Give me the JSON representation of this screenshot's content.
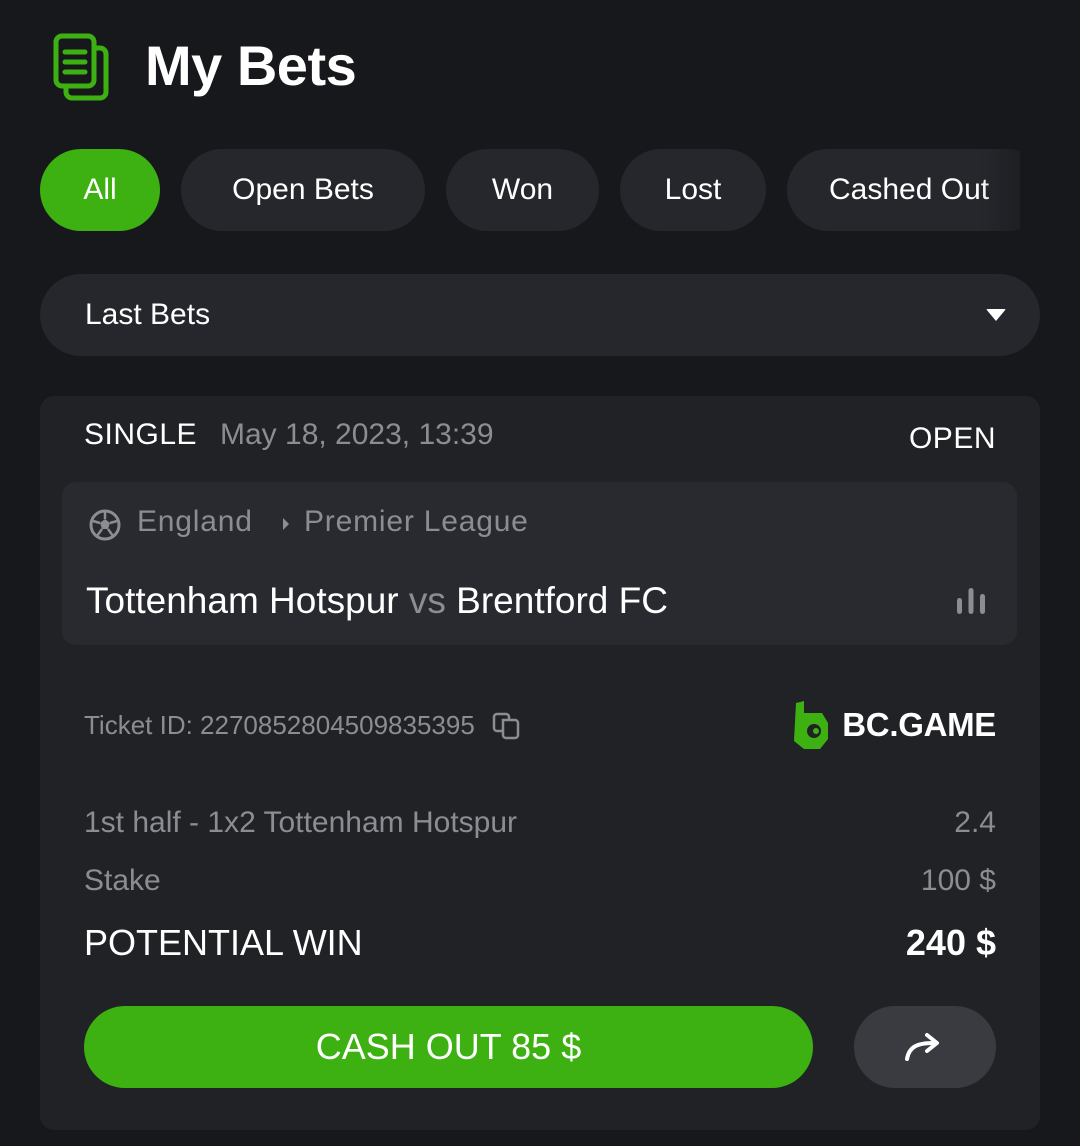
{
  "header": {
    "title": "My Bets",
    "icon": "bets-document-icon",
    "accent_color": "#3db112"
  },
  "filters": {
    "tabs": [
      {
        "label": "All",
        "active": true
      },
      {
        "label": "Open Bets",
        "active": false
      },
      {
        "label": "Won",
        "active": false
      },
      {
        "label": "Lost",
        "active": false
      },
      {
        "label": "Cashed Out",
        "active": false
      }
    ]
  },
  "dropdown": {
    "selected": "Last Bets",
    "icon": "caret-down-icon"
  },
  "bet": {
    "type": "SINGLE",
    "date": "May 18, 2023, 13:39",
    "status": "OPEN",
    "event": {
      "sport_icon": "soccer-ball-icon",
      "country": "England",
      "league": "Premier League",
      "home": "Tottenham Hotspur",
      "vs": "vs",
      "away": "Brentford FC",
      "stats_icon": "stats-bars-icon"
    },
    "ticket_id": "Ticket ID: 2270852804509835395",
    "copy_icon": "copy-icon",
    "brand": "BC.GAME",
    "selection": {
      "label": "1st half - 1x2 Tottenham Hotspur",
      "odds": "2.4"
    },
    "stake": {
      "label": "Stake",
      "value": "100 $"
    },
    "potential_win": {
      "label": "POTENTIAL WIN",
      "value": "240 $"
    },
    "cashout_label": "CASH OUT 85 $",
    "share_icon": "share-arrow-icon"
  }
}
